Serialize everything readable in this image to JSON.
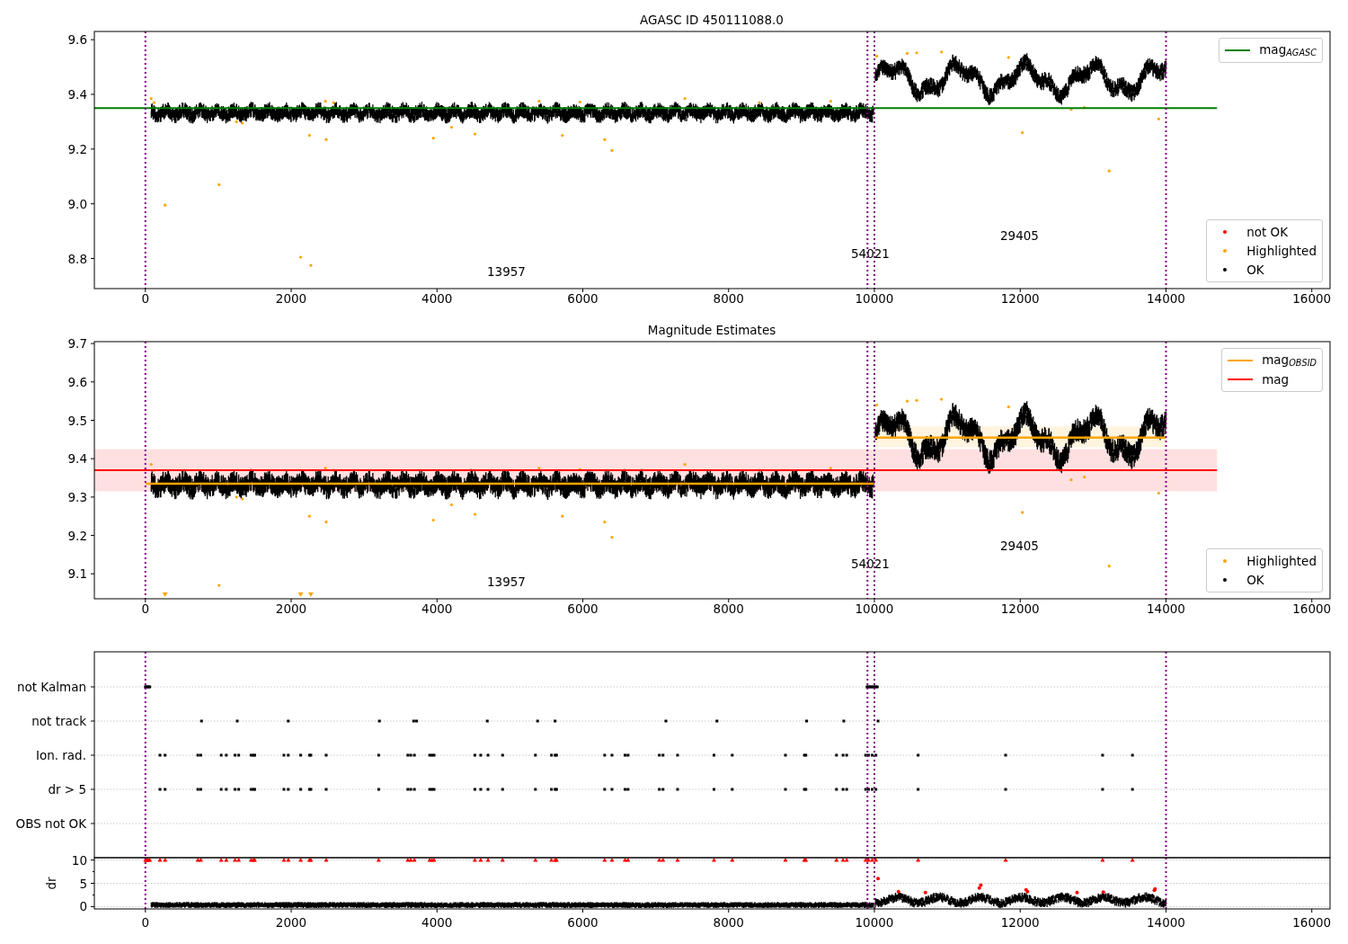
{
  "figure": {
    "panels": [
      {
        "kind": "magnitude",
        "title": "AGASC ID 450111088.0",
        "yticks": [
          "9.6",
          "9.4",
          "9.2",
          "9.0",
          "8.8"
        ],
        "xticks": [
          "0",
          "2000",
          "4000",
          "6000",
          "8000",
          "10000",
          "12000",
          "14000",
          "16000"
        ],
        "line_legend": [
          {
            "label": "mag$_{AGASC}$",
            "color": "#008000"
          }
        ],
        "point_legend": [
          {
            "label": "not OK",
            "color": "#ff0000"
          },
          {
            "label": "Highlighted",
            "color": "#ffa500"
          },
          {
            "label": "OK",
            "color": "#000000"
          }
        ],
        "annotations": [
          "13957",
          "54021",
          "29405"
        ]
      },
      {
        "kind": "magnitude",
        "title": "Magnitude Estimates",
        "yticks": [
          "9.7",
          "9.6",
          "9.5",
          "9.4",
          "9.3",
          "9.2",
          "9.1"
        ],
        "xticks": [
          "0",
          "2000",
          "4000",
          "6000",
          "8000",
          "10000",
          "12000",
          "14000",
          "16000"
        ],
        "line_legend": [
          {
            "label": "mag$_{OBSID}$",
            "color": "#ffa500"
          },
          {
            "label": "mag",
            "color": "#ff0000"
          }
        ],
        "point_legend": [
          {
            "label": "Highlighted",
            "color": "#ffa500"
          },
          {
            "label": "OK",
            "color": "#000000"
          }
        ],
        "annotations": [
          "13957",
          "54021",
          "29405"
        ]
      },
      {
        "kind": "flags",
        "categories": [
          "not Kalman",
          "not track",
          "Ion. rad.",
          "dr > 5",
          "OBS not OK"
        ]
      },
      {
        "kind": "dr",
        "ylabel": "dr",
        "yticks": [
          "10",
          "5",
          "0"
        ],
        "xticks": [
          "0",
          "2000",
          "4000",
          "6000",
          "8000",
          "10000",
          "12000",
          "14000",
          "16000"
        ]
      }
    ]
  }
}
